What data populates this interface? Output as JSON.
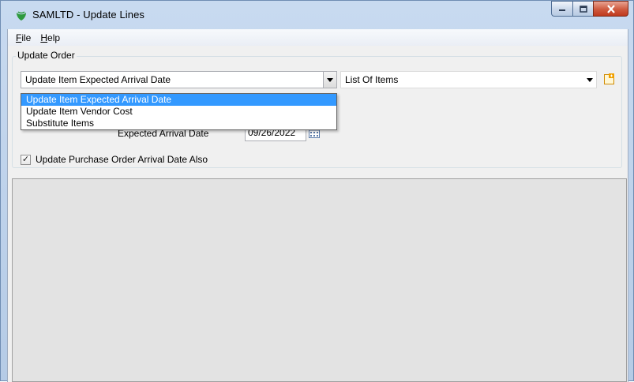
{
  "window": {
    "title": "SAMLTD - Update Lines"
  },
  "menu": {
    "file": "F",
    "file_rest": "ile",
    "help": "H",
    "help_rest": "elp"
  },
  "update_order": {
    "group_label": "Update Order",
    "selected_value": "Update Item Expected Arrival Date",
    "options": [
      "Update Item Expected Arrival Date",
      "Update Item Vendor Cost",
      "Substitute Items"
    ],
    "list_combo_value": "List Of Items"
  },
  "expected_arrival": {
    "label": "Expected Arrival Date",
    "value": "09/26/2022"
  },
  "checkbox": {
    "label": "Update Purchase Order Arrival Date Also",
    "checked": true,
    "mark": "✓"
  },
  "colors": {
    "selection": "#3399ff",
    "close_button": "#c0391d"
  }
}
